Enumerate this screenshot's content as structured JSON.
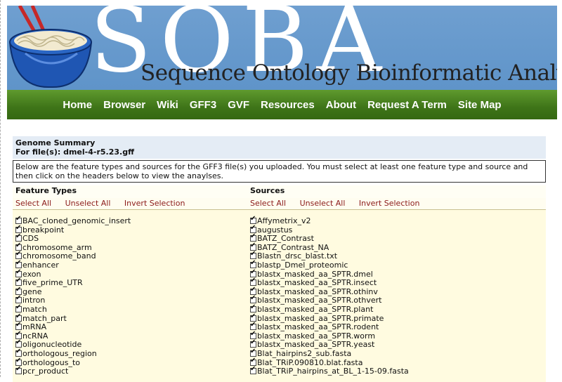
{
  "banner": {
    "logo_text": "SOBA",
    "subtitle": "Sequence Ontology Bioinformatic Analysis"
  },
  "nav": {
    "items": [
      "Home",
      "Browser",
      "Wiki",
      "GFF3",
      "GVF",
      "Resources",
      "About",
      "Request A Term",
      "Site Map"
    ]
  },
  "summary": {
    "title": "Genome Summary",
    "file_line": "For file(s):  dmel-4-r5.23.gff"
  },
  "intro": "Below are the feature types and sources for the GFF3 file(s) you uploaded. You must select at least one feature type and source and then click on the headers below to view the anaylses.",
  "feature_types": {
    "header": "Feature Types",
    "select_all": "Select All",
    "unselect_all": "Unselect All",
    "invert": "Invert Selection",
    "items": [
      "BAC_cloned_genomic_insert",
      "breakpoint",
      "CDS",
      "chromosome_arm",
      "chromosome_band",
      "enhancer",
      "exon",
      "five_prime_UTR",
      "gene",
      "intron",
      "match",
      "match_part",
      "mRNA",
      "ncRNA",
      "oligonucleotide",
      "orthologous_region",
      "orthologous_to",
      "pcr_product"
    ]
  },
  "sources": {
    "header": "Sources",
    "select_all": "Select All",
    "unselect_all": "Unselect All",
    "invert": "Invert Selection",
    "items": [
      "Affymetrix_v2",
      "augustus",
      "BATZ_Contrast",
      "BATZ_Contrast_NA",
      "Blastn_drsc_blast.txt",
      "blastp_Dmel_proteomic",
      "blastx_masked_aa_SPTR.dmel",
      "blastx_masked_aa_SPTR.insect",
      "blastx_masked_aa_SPTR.othinv",
      "blastx_masked_aa_SPTR.othvert",
      "blastx_masked_aa_SPTR.plant",
      "blastx_masked_aa_SPTR.primate",
      "blastx_masked_aa_SPTR.rodent",
      "blastx_masked_aa_SPTR.worm",
      "blastx_masked_aa_SPTR.yeast",
      "Blat_hairpins2_sub.fasta",
      "Blat_TRiP.090810.blat.fasta",
      "Blat_TRiP_hairpins_at_BL_1-15-09.fasta"
    ]
  }
}
